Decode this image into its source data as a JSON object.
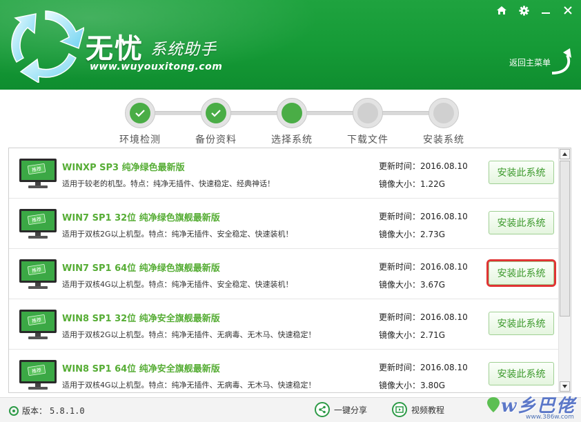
{
  "app": {
    "brand_main": "无忧",
    "brand_sub": "系统助手",
    "url": "www.wuyouxitong.com",
    "back_menu": "返回主菜单"
  },
  "window_controls": [
    "home-icon",
    "gear-icon",
    "minimize-icon",
    "close-icon"
  ],
  "steps": [
    {
      "label": "环境检测",
      "status": "done"
    },
    {
      "label": "备份资料",
      "status": "done"
    },
    {
      "label": "选择系统",
      "status": "active"
    },
    {
      "label": "下载文件",
      "status": "pending"
    },
    {
      "label": "安装系统",
      "status": "pending"
    }
  ],
  "badge_label": "推荐",
  "systems": [
    {
      "title": "WINXP SP3 纯净绿色最新版",
      "desc": "适用于较老的机型。特点：纯净无插件、快速稳定、经典神话！",
      "update": "更新时间：2016.08.10",
      "size": "镜像大小：1.22G",
      "button": "安装此系统",
      "highlighted": false
    },
    {
      "title": "WIN7 SP1 32位 纯净绿色旗舰最新版",
      "desc": "适用于双核2G以上机型。特点：纯净无插件、安全稳定、快速装机！",
      "update": "更新时间：2016.08.10",
      "size": "镜像大小：2.73G",
      "button": "安装此系统",
      "highlighted": false
    },
    {
      "title": "WIN7 SP1 64位 纯净绿色旗舰最新版",
      "desc": "适用于双核4G以上机型。特点：纯净无插件、安全稳定、快速装机！",
      "update": "更新时间：2016.08.10",
      "size": "镜像大小：3.67G",
      "button": "安装此系统",
      "highlighted": true
    },
    {
      "title": "WIN8 SP1 32位 纯净安全旗舰最新版",
      "desc": "适用于双核2G以上机型。特点：纯净无插件、无病毒、无木马、快速稳定！",
      "update": "更新时间：2016.08.10",
      "size": "镜像大小：2.71G",
      "button": "安装此系统",
      "highlighted": false
    },
    {
      "title": "WIN8 SP1 64位 纯净安全旗舰最新版",
      "desc": "适用于双核4G以上机型。特点：纯净无插件、无病毒、无木马、快速稳定！",
      "update": "更新时间：2016.08.10",
      "size": "镜像大小：3.80G",
      "button": "安装此系统",
      "highlighted": false
    }
  ],
  "footer": {
    "version_label": "版本：",
    "version": "5.8.1.0",
    "share": "一键分享",
    "video": "视频教程"
  },
  "watermark": {
    "text": "w乡巴佬",
    "url": "www.386w.com"
  },
  "colors": {
    "brand_green": "#159a36",
    "title_green": "#56ad35",
    "highlight_red": "#e03434"
  }
}
